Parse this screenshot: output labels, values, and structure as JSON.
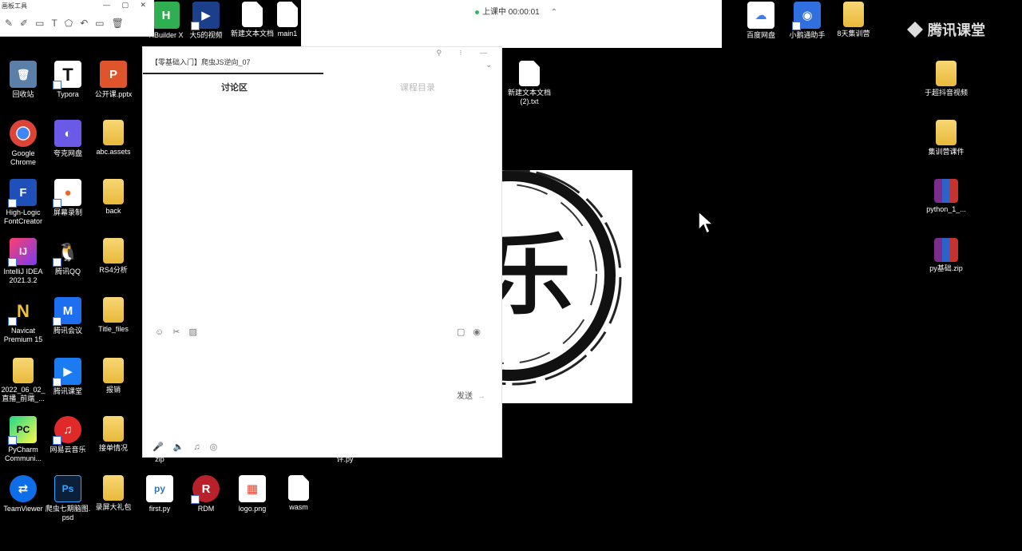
{
  "toolbar_left": {
    "title": "画板工具",
    "window_controls": "— ▢ ✕",
    "tools": "✎✐▭T⬠↶▭🗑"
  },
  "class_status": {
    "text": "上课中 00:00:01",
    "chevron": "⌃"
  },
  "brand": {
    "name": "腾讯课堂"
  },
  "chat": {
    "title": "【零基础入门】爬虫JS逆向_07",
    "top_controls": "⚲ ⁝ —",
    "dropdown": "⌄",
    "tab_discussion": "讨论区",
    "tab_other": "课程目录",
    "toolbar_icons": "☺✂▨",
    "toolbar_icons_right": "▢◉",
    "send_label": "发送",
    "send_arrow": "→",
    "bottom_icons": "🎤🔈♫◎"
  },
  "desktop_icons": [
    {
      "id": "hbuilder",
      "label": "HBuilder X",
      "icon": "H"
    },
    {
      "id": "video5",
      "label": "大5的视频",
      "icon": "▶"
    },
    {
      "id": "newtxt1",
      "label": "新建文本文档",
      "icon": ""
    },
    {
      "id": "main1",
      "label": "main1",
      "icon": ""
    },
    {
      "id": "baidu",
      "label": "百度网盘",
      "icon": "☁"
    },
    {
      "id": "xiaoe",
      "label": "小鹅通助手",
      "icon": "◉"
    },
    {
      "id": "bday",
      "label": "8天集训营",
      "icon": ""
    },
    {
      "id": "recycle",
      "label": "回收站",
      "icon": "🗑"
    },
    {
      "id": "typora",
      "label": "Typora",
      "icon": "T"
    },
    {
      "id": "pptx",
      "label": "公开课.pptx",
      "icon": "P"
    },
    {
      "id": "newtxt2",
      "label": "新建文本文档\n(2).txt",
      "icon": ""
    },
    {
      "id": "yuchao",
      "label": "于超抖音视频",
      "icon": ""
    },
    {
      "id": "chrome",
      "label": "Google\nChrome",
      "icon": "◎"
    },
    {
      "id": "quark",
      "label": "夸克网盘",
      "icon": "◐"
    },
    {
      "id": "abcassets",
      "label": "abc.assets",
      "icon": ""
    },
    {
      "id": "jixun",
      "label": "集训营课件",
      "icon": ""
    },
    {
      "id": "fontcreator",
      "label": "High-Logic\nFontCreator",
      "icon": "F"
    },
    {
      "id": "screenrec",
      "label": "屏幕录制",
      "icon": "●"
    },
    {
      "id": "back",
      "label": "back",
      "icon": ""
    },
    {
      "id": "python1",
      "label": "python_1_...",
      "icon": ""
    },
    {
      "id": "idea",
      "label": "IntelliJ IDEA\n2021.3.2",
      "icon": "IJ"
    },
    {
      "id": "qq",
      "label": "腾讯QQ",
      "icon": "🐧"
    },
    {
      "id": "rs4",
      "label": "RS4分析",
      "icon": ""
    },
    {
      "id": "pyzip",
      "label": "py基础.zip",
      "icon": ""
    },
    {
      "id": "navicat",
      "label": "Navicat\nPremium 15",
      "icon": "N"
    },
    {
      "id": "tmeeting",
      "label": "腾讯会议",
      "icon": "M"
    },
    {
      "id": "titlefiles",
      "label": "Title_files",
      "icon": ""
    },
    {
      "id": "live0602",
      "label": "2022_06_02_\n直播_前端_...",
      "icon": ""
    },
    {
      "id": "tclass",
      "label": "腾讯课堂",
      "icon": "▶"
    },
    {
      "id": "baoxiao",
      "label": "报销",
      "icon": ""
    },
    {
      "id": "pycharm",
      "label": "PyCharm\nCommuni...",
      "icon": "PC"
    },
    {
      "id": "netease",
      "label": "网易云音乐",
      "icon": "♫"
    },
    {
      "id": "jiedan",
      "label": "接单情况",
      "icon": ""
    },
    {
      "id": "teamviewer",
      "label": "TeamViewer",
      "icon": "⇄"
    },
    {
      "id": "psd",
      "label": "爬虫七期脑图.\npsd",
      "icon": "Ps"
    },
    {
      "id": "luping",
      "label": "录屏大礼包",
      "icon": ""
    },
    {
      "id": "firstpy",
      "label": "first.py",
      "icon": "py"
    },
    {
      "id": "rdm",
      "label": "RDM",
      "icon": "R"
    },
    {
      "id": "logopng",
      "label": "logo.png",
      "icon": "▦"
    },
    {
      "id": "wasm",
      "label": "wasm",
      "icon": ""
    },
    {
      "id": "zip_hidden",
      "label": "zip",
      "icon": ""
    },
    {
      "id": "py_hidden",
      "label": "评.py",
      "icon": ""
    }
  ],
  "ink_image": {
    "glyph": "乐"
  },
  "colors": {
    "accent": "#2bbd5c",
    "desktop": "#000000"
  }
}
